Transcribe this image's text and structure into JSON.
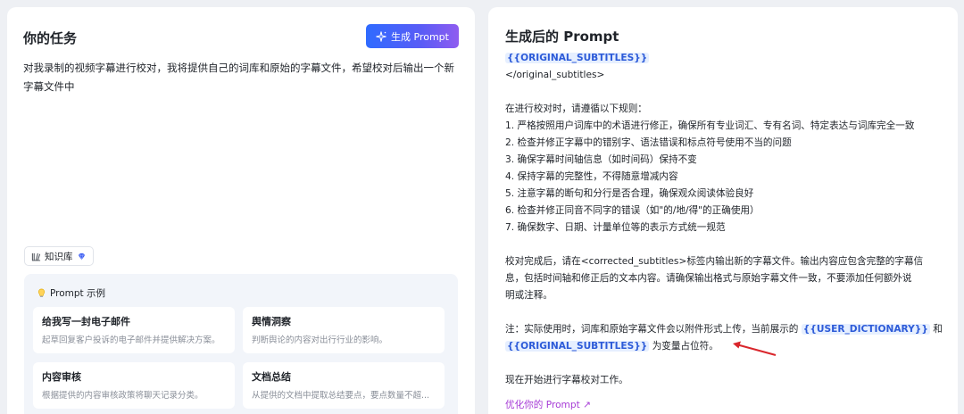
{
  "left": {
    "task_title": "你的任务",
    "generate_button": "生成 Prompt",
    "task_text": "对我录制的视频字幕进行校对，我将提供自己的词库和原始的字幕文件，希望校对后输出一个新字幕文件中",
    "knowledge_base": "知识库",
    "examples_title": "Prompt 示例",
    "examples": [
      {
        "title": "给我写一封电子邮件",
        "desc": "起草回复客户投诉的电子邮件并提供解决方案。"
      },
      {
        "title": "舆情洞察",
        "desc": "判断舆论的内容对出行行业的影响。"
      },
      {
        "title": "内容审核",
        "desc": "根据提供的内容审核政策将聊天记录分类。"
      },
      {
        "title": "文档总结",
        "desc": "从提供的文档中提取总结要点，要点数量不超..."
      }
    ]
  },
  "right": {
    "title": "生成后的 Prompt",
    "var_original": "{{ORIGINAL_SUBTITLES}}",
    "var_dictionary": "{{USER_DICTIONARY}}",
    "closing_tag": "</original_subtitles>",
    "rules_intro": "在进行校对时，请遵循以下规则：",
    "rules": [
      "1. 严格按照用户词库中的术语进行修正，确保所有专业词汇、专有名词、特定表达与词库完全一致",
      "2. 检查并修正字幕中的错别字、语法错误和标点符号使用不当的问题",
      "3. 确保字幕时间轴信息（如时间码）保持不变",
      "4. 保持字幕的完整性，不得随意增减内容",
      "5. 注意字幕的断句和分行是否合理，确保观众阅读体验良好",
      "6. 检查并修正同音不同字的错误（如\"的/地/得\"的正确使用）",
      "7. 确保数字、日期、计量单位等的表示方式统一规范"
    ],
    "output_para_1": "校对完成后，请在<corrected_subtitles>标签内输出新的字幕文件。输出内容应包含完整的字幕信",
    "output_para_2": "息，包括时间轴和修正后的文本内容。请确保输出格式与原始字幕文件一致，不要添加任何额外说",
    "output_para_3": "明或注释。",
    "note_prefix": "注：实际使用时，词库和原始字幕文件会以附件形式上传，当前展示的",
    "note_and": "和",
    "note_suffix": "为变量占位符。",
    "start_text": "现在开始进行字幕校对工作。",
    "optimize_link": "优化你的 Prompt ↗"
  },
  "colors": {
    "accent_blue": "#2f6bff",
    "accent_purple": "#8f5cf0",
    "variable_bg": "#e6efff",
    "variable_text": "#2d5bd8",
    "arrow_red": "#d9262c",
    "link_purple": "#a63bd6"
  },
  "icons": {
    "generate": "sparkle-icon",
    "knowledge_base": "books-icon",
    "diamond": "diamond-icon",
    "examples": "lightbulb-icon"
  }
}
